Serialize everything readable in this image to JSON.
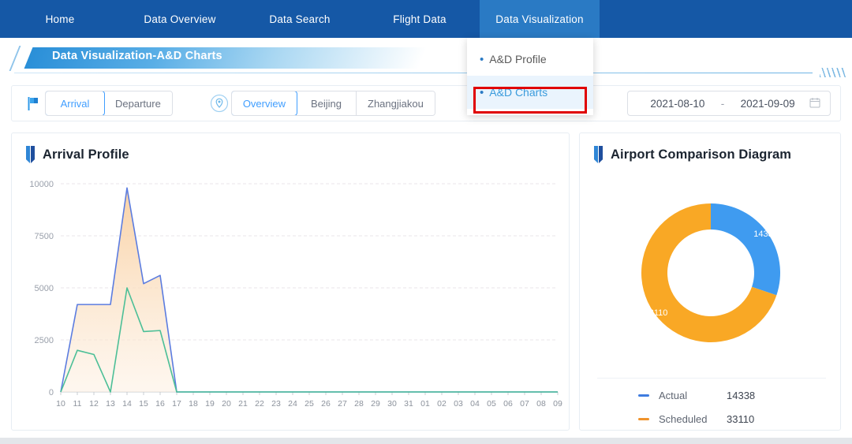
{
  "nav": {
    "items": [
      {
        "label": "Home",
        "active": false
      },
      {
        "label": "Data Overview",
        "active": false
      },
      {
        "label": "Data Search",
        "active": false
      },
      {
        "label": "Flight Data",
        "active": false
      },
      {
        "label": "Data Visualization",
        "active": true
      }
    ],
    "background": "#1558a6",
    "active_background": "#2a7ac4"
  },
  "dropdown": {
    "items": [
      {
        "label": "A&D Profile",
        "selected": false
      },
      {
        "label": "A&D Charts",
        "selected": true
      }
    ],
    "bullet": "•",
    "highlight_color": "#e00000"
  },
  "title": {
    "text": "Data Visualization-A&D Charts"
  },
  "toolbar": {
    "flag_icon": "flag-icon",
    "pin_icon": "location-pin-icon",
    "direction": {
      "options": [
        {
          "label": "Arrival",
          "active": true
        },
        {
          "label": "Departure",
          "active": false
        }
      ]
    },
    "airports": {
      "options": [
        {
          "label": "Overview",
          "active": true
        },
        {
          "label": "Beijing",
          "active": false
        },
        {
          "label": "Zhangjiakou",
          "active": false
        }
      ]
    },
    "date_range": {
      "start": "2021-08-10",
      "separator": "-",
      "end": "2021-09-09",
      "calendar_icon": "calendar-icon"
    }
  },
  "left_panel": {
    "title": "Arrival Profile"
  },
  "right_panel": {
    "title": "Airport Comparison Diagram"
  },
  "chart_data": [
    {
      "type": "area",
      "title": "Arrival Profile",
      "xlabel": "",
      "ylabel": "",
      "ylim": [
        0,
        10000
      ],
      "yticks": [
        0,
        2500,
        5000,
        7500,
        10000
      ],
      "grid": true,
      "legend": "none",
      "categories": [
        "10",
        "11",
        "12",
        "13",
        "14",
        "15",
        "16",
        "17",
        "18",
        "19",
        "20",
        "21",
        "22",
        "23",
        "24",
        "25",
        "26",
        "27",
        "28",
        "29",
        "30",
        "31",
        "01",
        "02",
        "03",
        "04",
        "05",
        "06",
        "07",
        "08",
        "09"
      ],
      "series": [
        {
          "name": "Scheduled",
          "color": "#5b7ce0",
          "fill": "#fbe3c7",
          "values": [
            0,
            4200,
            4200,
            4200,
            9800,
            5200,
            5600,
            0,
            0,
            0,
            0,
            0,
            0,
            0,
            0,
            0,
            0,
            0,
            0,
            0,
            0,
            0,
            0,
            0,
            0,
            0,
            0,
            0,
            0,
            0,
            0
          ]
        },
        {
          "name": "Actual",
          "color": "#4cbf97",
          "fill": "none",
          "values": [
            0,
            2000,
            1800,
            0,
            5000,
            2900,
            2950,
            0,
            0,
            0,
            0,
            0,
            0,
            0,
            0,
            0,
            0,
            0,
            0,
            0,
            0,
            0,
            0,
            0,
            0,
            0,
            0,
            0,
            0,
            0,
            0
          ]
        }
      ]
    },
    {
      "type": "pie",
      "title": "Airport Comparison Diagram",
      "donut": true,
      "legend": "bottom",
      "labels": [
        "Actual",
        "Scheduled"
      ],
      "values": [
        14338,
        33110
      ],
      "colors": [
        "#3f9bf0",
        "#f9a825"
      ],
      "data_labels": [
        "14338",
        "33110"
      ]
    }
  ],
  "donut_legend": {
    "rows": [
      {
        "name": "Actual",
        "value": "14338",
        "color": "#3f7ce0"
      },
      {
        "name": "Scheduled",
        "value": "33110",
        "color": "#f0932b"
      }
    ]
  }
}
